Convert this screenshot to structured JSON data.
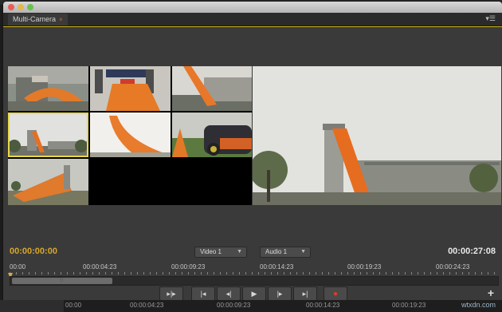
{
  "window": {
    "tab_label": "Multi-Camera",
    "tab_close": "×",
    "panel_menu": "▾☰"
  },
  "camera_grid": {
    "cameras": [
      {
        "name": "camera-1",
        "description": "aerial track"
      },
      {
        "name": "camera-2",
        "description": "ramp front"
      },
      {
        "name": "camera-3",
        "description": "ramp side"
      },
      {
        "name": "camera-4",
        "description": "selected tower wide"
      },
      {
        "name": "camera-5",
        "description": "ramp close"
      },
      {
        "name": "camera-6",
        "description": "car close"
      },
      {
        "name": "camera-7",
        "description": "ramp low"
      },
      {
        "name": "camera-8",
        "description": "empty"
      }
    ],
    "selected_index": 3,
    "selected_border_color": "#e8d84a"
  },
  "timecode": {
    "current": "00:00:00:00",
    "duration": "00:00:27:08",
    "current_color": "#d8a72a"
  },
  "track_select": {
    "video": "Video 1",
    "audio": "Audio 1"
  },
  "ruler": {
    "ticks": [
      "00:00",
      "00:00:04:23",
      "00:00:09:23",
      "00:00:14:23",
      "00:00:19:23",
      "00:00:24:23"
    ]
  },
  "transport": {
    "buttons": [
      {
        "name": "trim-button",
        "glyph": "▸|▸"
      },
      {
        "name": "go-to-in-button",
        "glyph": "|◂"
      },
      {
        "name": "step-back-button",
        "glyph": "◂|"
      },
      {
        "name": "play-button",
        "glyph": "▶"
      },
      {
        "name": "step-forward-button",
        "glyph": "|▸"
      },
      {
        "name": "go-to-out-button",
        "glyph": "▸|"
      },
      {
        "name": "record-button",
        "glyph": "●"
      }
    ],
    "add_button": "+"
  },
  "bottom_timeline": {
    "ticks": [
      "00:00",
      "00:00:04:23",
      "00:00:09:23",
      "00:00:14:23",
      "00:00:19:23"
    ],
    "watermark": "wtxdn.com"
  }
}
